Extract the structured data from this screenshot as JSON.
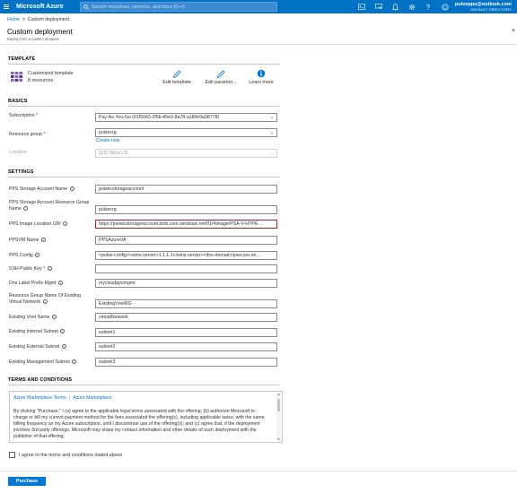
{
  "topbar": {
    "brand": "Microsoft Azure",
    "search_placeholder": "Search resources, services, and docs (G+/)",
    "icons": [
      "cloud-shell-icon",
      "directory-filter-icon",
      "notifications-icon",
      "settings-icon",
      "help-icon",
      "feedback-icon"
    ],
    "account_email": "pulsepps@outlook.com",
    "account_directory": "DEFAULT DIRECTORY",
    "bg_color": "#0072c6"
  },
  "breadcrumb": {
    "home": "Home",
    "separator": ">",
    "current": "Custom deployment"
  },
  "header": {
    "title": "Custom deployment",
    "subtitle": "Deploy from a custom template",
    "close": "×"
  },
  "template": {
    "section_title": "TEMPLATE",
    "name": "Customized template",
    "resources": "8 resources",
    "actions": {
      "edit_template": "Edit template",
      "edit_parameters": "Edit paramet...",
      "learn_more": "Learn more"
    }
  },
  "basics": {
    "section_title": "BASICS",
    "subscription_label": "Subscription",
    "subscription_value": "Pay-As-You-Go (01f5060-2f5b-45e9-8a78-a180e9a38778)",
    "resource_group_label": "Resource group",
    "resource_group_value": "pulsecrg",
    "create_new": "Create new",
    "location_label": "Location",
    "location_value": "(US) West US",
    "required_mark": "*"
  },
  "settings": {
    "section_title": "SETTINGS",
    "fields": [
      {
        "label": "PPS Storage Account Name",
        "value": "pulsecstorageaccount"
      },
      {
        "label": "PPS Storage Account Resource Group Name",
        "value": "pulsecrg"
      },
      {
        "label": "PPS Image Location URI",
        "value": "https://pulsecstorageaccount.blob.core.windows.net/91r4image/PSA-V-HYPE..."
      },
      {
        "label": "PPSVM Name",
        "value": "PPSAzureVA"
      },
      {
        "label": "PPS Config",
        "value": "<pulse-config><wins-server>1.1.1.1</wins-server><dns-domain>psecure.ne..."
      },
      {
        "label": "SSH Public Key",
        "value": ""
      },
      {
        "label": "Dns Label Prefix Mgmt",
        "value": "mycloudppsmgmt"
      },
      {
        "label": "Resource Group Name Of Existing Virtual Network",
        "value": "ExistingVnetRG"
      },
      {
        "label": "Existing Vnet Name",
        "value": "virtualNetwork"
      },
      {
        "label": "Existing Internal Subnet",
        "value": "subnet1"
      },
      {
        "label": "Existing External Subnet",
        "value": "subnet2"
      },
      {
        "label": "Existing Management Subnet",
        "value": "subnet3"
      }
    ]
  },
  "terms": {
    "section_title": "TERMS AND CONDITIONS",
    "link1": "Azure Marketplace Terms",
    "separator": "|",
    "link2": "Azure Marketplace",
    "text": "By clicking \"Purchase,\" I (a) agree to the applicable legal terms associated with the offering; (b) authorize Microsoft to charge or bill my current payment method for the fees associated the offering(s), including applicable taxes, with the same billing frequency as my Azure subscription, until I discontinue use of the offering(s); and (c) agree that, if the deployment involves 3rd party offerings, Microsoft may share my contact information and other details of such deployment with the publisher of that offering.",
    "agree_label": "I agree to the terms and conditions stated above"
  },
  "footer": {
    "purchase": "Purchase"
  },
  "colors": {
    "accent": "#0078d4",
    "required": "#a4262c"
  }
}
